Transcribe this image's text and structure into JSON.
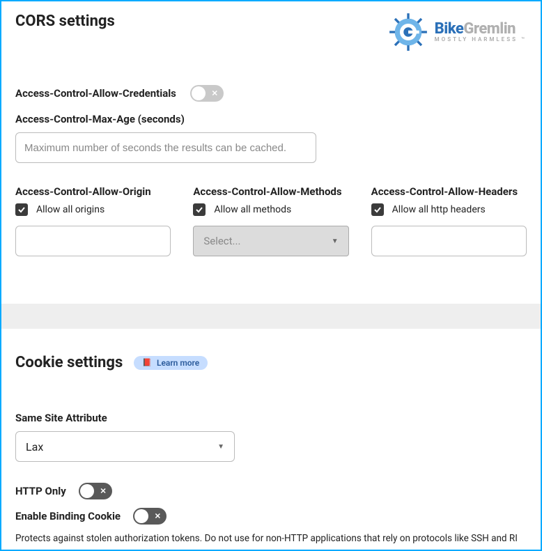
{
  "cors": {
    "title": "CORS settings",
    "allowCredentials": {
      "label": "Access-Control-Allow-Credentials",
      "enabled": false
    },
    "maxAge": {
      "label": "Access-Control-Max-Age (seconds)",
      "placeholder": "Maximum number of seconds the results can be cached.",
      "value": ""
    },
    "allowOrigin": {
      "label": "Access-Control-Allow-Origin",
      "checkLabel": "Allow all origins",
      "checked": true,
      "value": ""
    },
    "allowMethods": {
      "label": "Access-Control-Allow-Methods",
      "checkLabel": "Allow all methods",
      "checked": true,
      "selectPlaceholder": "Select..."
    },
    "allowHeaders": {
      "label": "Access-Control-Allow-Headers",
      "checkLabel": "Allow all http headers",
      "checked": true,
      "value": ""
    }
  },
  "cookie": {
    "title": "Cookie settings",
    "learnMore": "Learn more",
    "sameSite": {
      "label": "Same Site Attribute",
      "value": "Lax"
    },
    "httpOnly": {
      "label": "HTTP Only",
      "enabled": false
    },
    "bindingCookie": {
      "label": "Enable Binding Cookie",
      "enabled": false,
      "help": "Protects against stolen authorization tokens. Do not use for non-HTTP applications that rely on protocols like SSH and RI"
    }
  },
  "branding": {
    "name1": "Bike",
    "name2": "Gremlin",
    "tagline": "MOSTLY HARMLESS ™"
  }
}
